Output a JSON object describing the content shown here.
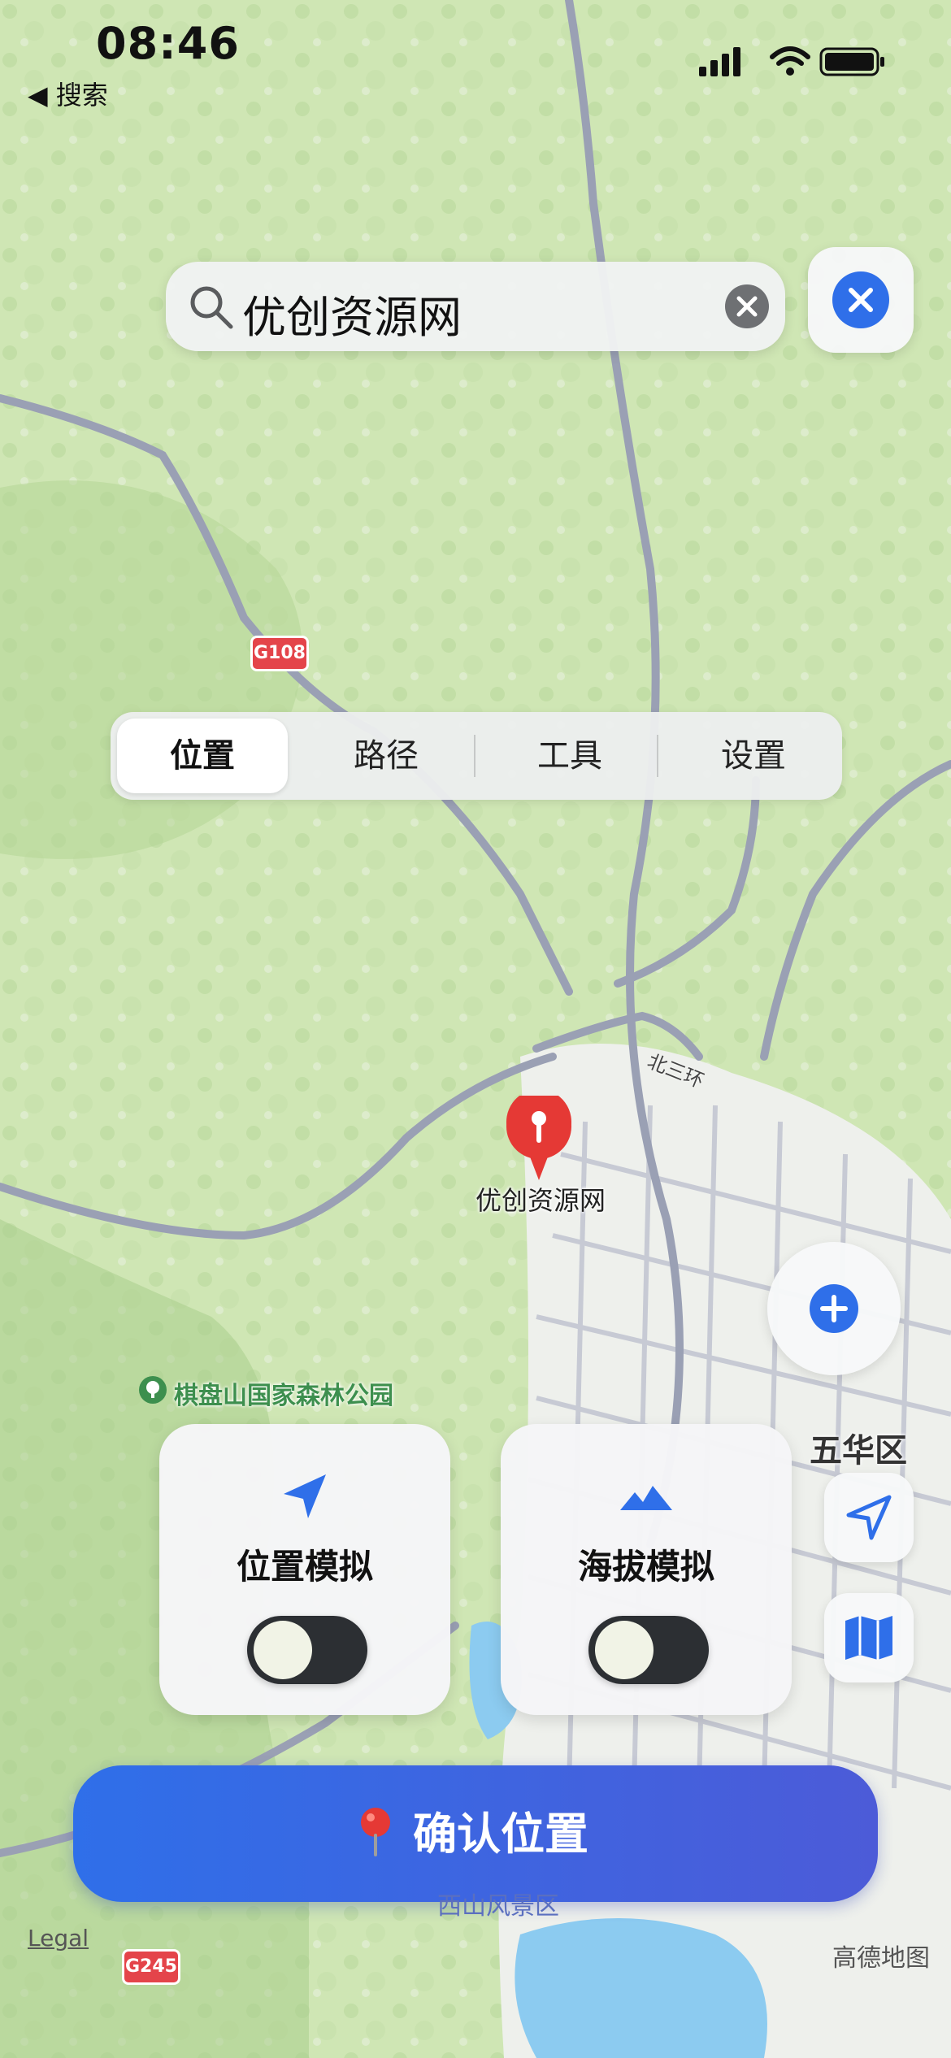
{
  "status_bar": {
    "time": "08:46",
    "back_label": "◀ 搜索"
  },
  "search": {
    "query": "优创资源网"
  },
  "tabs": [
    {
      "label": "位置",
      "active": true
    },
    {
      "label": "路径",
      "active": false
    },
    {
      "label": "工具",
      "active": false
    },
    {
      "label": "设置",
      "active": false
    }
  ],
  "map": {
    "pin_label": "优创资源网",
    "poi_label": "棋盘山国家森林公园",
    "district_label": "五华区",
    "road_label_north": "北三环",
    "highway_g108": "G108",
    "highway_g245": "G245",
    "scenic_label": "西山风景区",
    "legal_label": "Legal",
    "provider_label": "高德地图"
  },
  "cards": {
    "location_sim": {
      "title": "位置模拟",
      "icon": "navigation-arrow-icon",
      "enabled": false
    },
    "altitude_sim": {
      "title": "海拔模拟",
      "icon": "mountain-icon",
      "enabled": false
    }
  },
  "confirm_button": {
    "label": "确认位置",
    "icon": "red-pin-icon"
  },
  "colors": {
    "accent": "#2f6fe9",
    "pin_red": "#e53935",
    "map_green": "#cfe6b4"
  }
}
